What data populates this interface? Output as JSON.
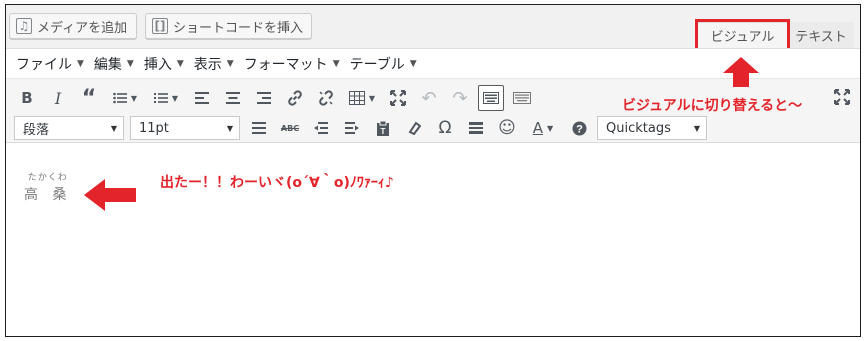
{
  "toolbar_top": {
    "add_media": "メディアを追加",
    "insert_shortcode": "ショートコードを挿入"
  },
  "tabs": {
    "visual": "ビジュアル",
    "text": "テキスト"
  },
  "menubar": [
    {
      "label": "ファイル"
    },
    {
      "label": "編集"
    },
    {
      "label": "挿入"
    },
    {
      "label": "表示"
    },
    {
      "label": "フォーマット"
    },
    {
      "label": "テーブル"
    }
  ],
  "format": {
    "paragraph": "段落",
    "font_size": "11pt",
    "quicktags": "Quicktags"
  },
  "content": {
    "ruby_text": "たかくわ",
    "ruby_base": "高 桑"
  },
  "annotations": {
    "toggle_note": "ビジュアルに切り替えると～",
    "result_note": "出たー！！わーいヾ(o´∀｀o)ﾉﾜｧｰｨ♪",
    "color": "#e3242b"
  }
}
